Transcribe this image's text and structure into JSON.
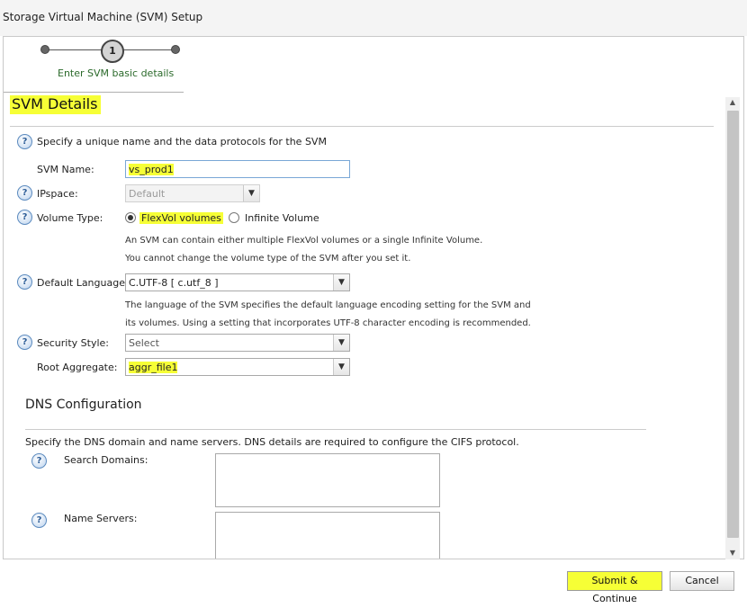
{
  "window": {
    "title": "Storage Virtual Machine (SVM) Setup"
  },
  "wizard": {
    "step_number": "1",
    "step_label": "Enter SVM basic details"
  },
  "svm_details": {
    "section_title": "SVM Details",
    "intro": "Specify a unique name and the data protocols for the SVM",
    "svm_name": {
      "label": "SVM Name:",
      "value": "vs_prod1"
    },
    "ipspace": {
      "label": "IPspace:",
      "value": "Default"
    },
    "volume_type": {
      "label": "Volume Type:",
      "options": [
        "FlexVol volumes",
        "Infinite Volume"
      ],
      "selected": "FlexVol volumes",
      "note1": "An SVM can contain either multiple FlexVol volumes or a single Infinite Volume.",
      "note2": "You cannot change the volume type of the SVM after you set it."
    },
    "default_language": {
      "label": "Default Language:",
      "value": "C.UTF-8 [ c.utf_8 ]",
      "note1": "The language of the SVM specifies the default language encoding setting for the SVM and",
      "note2": "its volumes. Using a setting that incorporates UTF-8 character encoding is recommended."
    },
    "security_style": {
      "label": "Security Style:",
      "value": "Select"
    },
    "root_aggregate": {
      "label": "Root Aggregate:",
      "value": "aggr_file1"
    }
  },
  "dns": {
    "section_title": "DNS Configuration",
    "intro": "Specify the DNS domain and name servers. DNS details are required to configure the CIFS protocol.",
    "search_domains_label": "Search Domains:",
    "search_domains_value": "",
    "name_servers_label": "Name Servers:",
    "name_servers_value": ""
  },
  "buttons": {
    "submit": "Submit & Continue",
    "cancel": "Cancel"
  },
  "icons": {
    "help": "?",
    "dropdown": "▼",
    "scroll_up": "▲",
    "scroll_down": "▼"
  },
  "colors": {
    "highlight": "#f6ff36",
    "link_green": "#2b6a2b",
    "input_border": "#7aa7d6"
  }
}
